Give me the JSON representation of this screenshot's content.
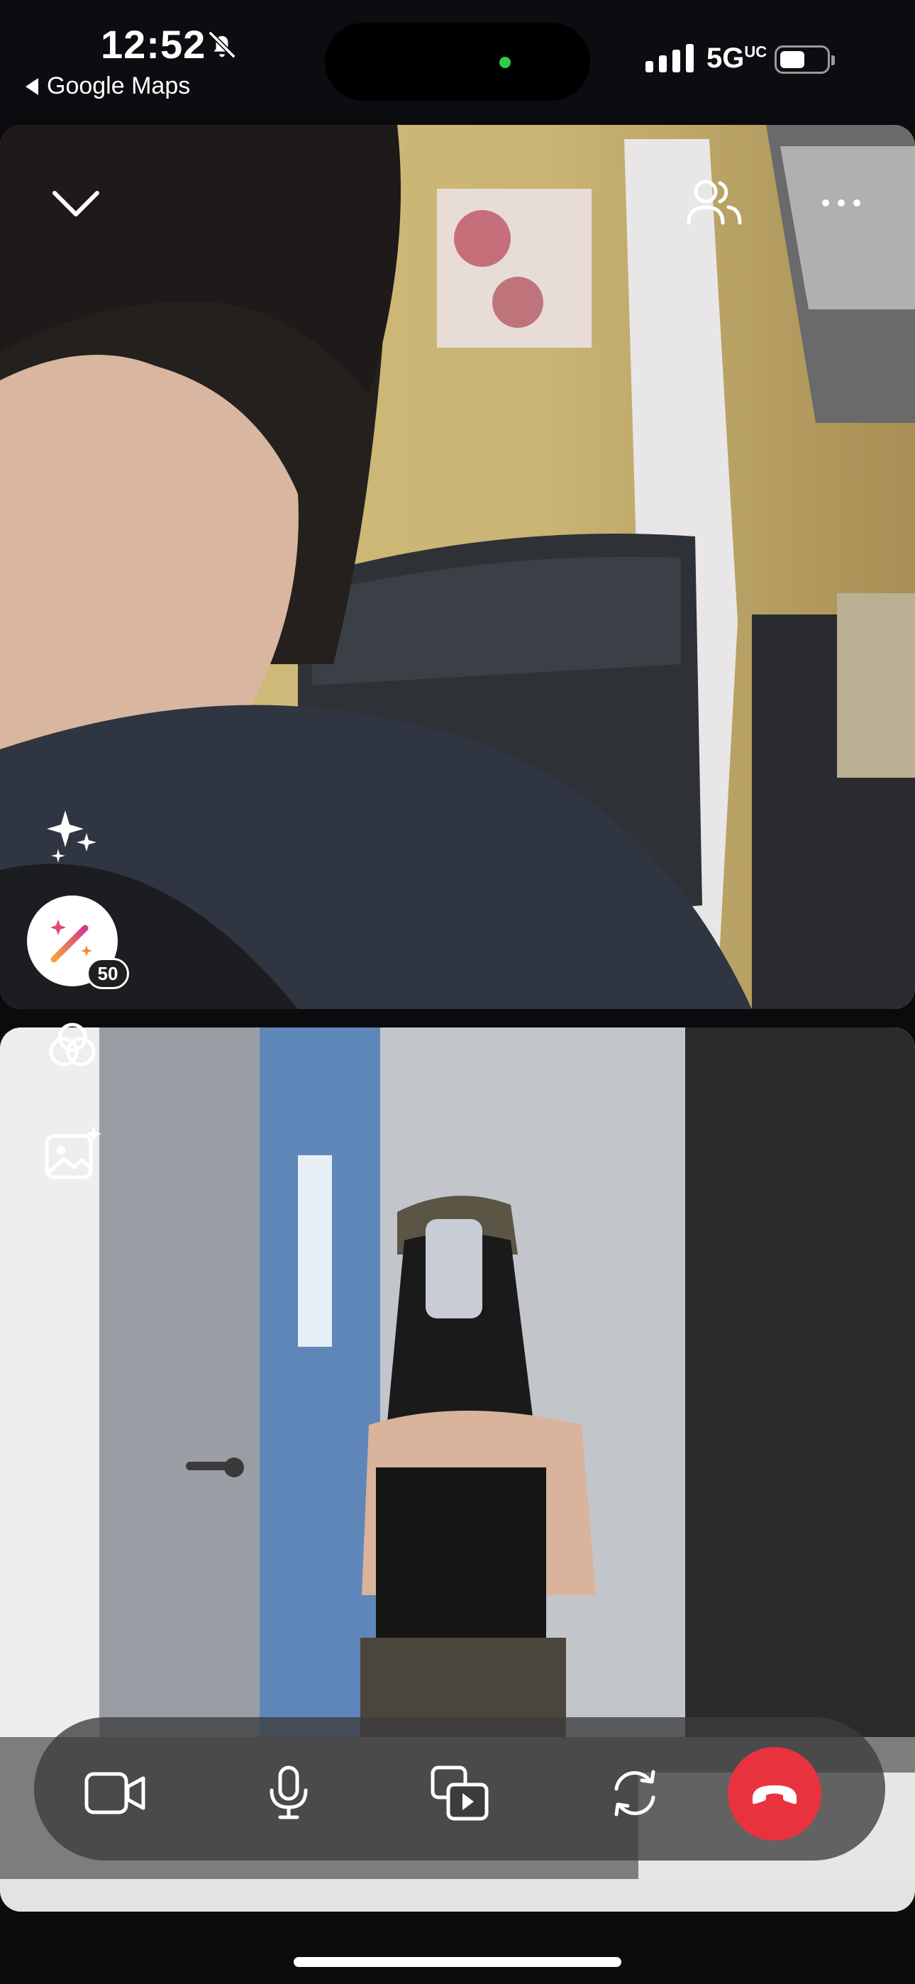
{
  "status_bar": {
    "time": "12:52",
    "back_app": "Google Maps",
    "network": "5G",
    "network_suffix": "UC"
  },
  "effects": {
    "badge_count": "50"
  },
  "icons": {
    "collapse": "chevron-down-icon",
    "participants": "people-icon",
    "more": "more-icon",
    "sparkles": "sparkles-icon",
    "effects": "magic-wand-icon",
    "filters": "overlap-circles-icon",
    "backgrounds": "image-sparkle-icon",
    "camera": "video-camera-icon",
    "mic": "microphone-icon",
    "share": "media-share-icon",
    "flip": "flip-camera-icon",
    "end_call": "phone-hangup-icon"
  },
  "colors": {
    "end_call": "#e8333f",
    "toolbar_bg": "#3c3c3e",
    "camera_dot": "#2ecc48"
  }
}
